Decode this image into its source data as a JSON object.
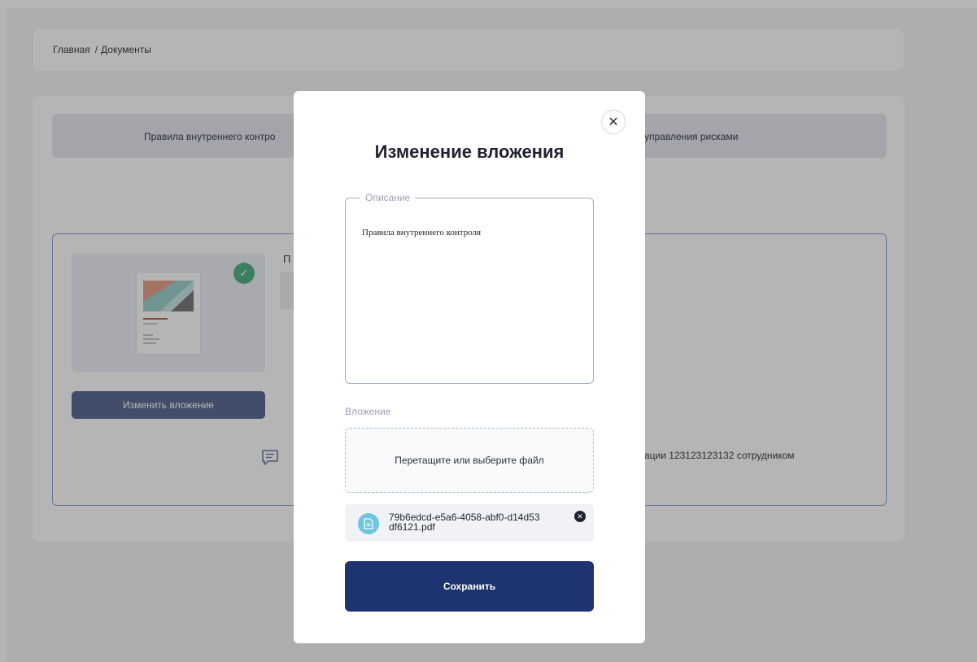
{
  "breadcrumb": {
    "home": "Главная",
    "separator": "/",
    "current": "Документы"
  },
  "tabs": {
    "left_fragment": "Правила внутреннего контро",
    "right_fragment": "управления рисками"
  },
  "document_card": {
    "title_fragment": "П",
    "change_button": "Изменить вложение",
    "comment_fragment": "",
    "info_fragment": "ации 123123123132 сотрудником"
  },
  "modal": {
    "title": "Изменение вложения",
    "description": {
      "legend": "Описание",
      "value": "Правила внутреннего контроля"
    },
    "attachment": {
      "label": "Вложение",
      "dropzone_text": "Перетащите или выберите файл",
      "file_name": "79b6edcd-e5a6-4058-abf0-d14d53df6121.pdf"
    },
    "save_button": "Сохранить"
  },
  "colors": {
    "primary": "#1e3471",
    "check_green": "#55b388",
    "file_icon": "#6fc4de",
    "overlay": "rgba(0,0,0,0.29)"
  },
  "icons": {
    "close": "close-icon",
    "check": "check-icon",
    "file": "file-icon",
    "remove": "remove-file-icon",
    "comment": "comment-icon"
  }
}
